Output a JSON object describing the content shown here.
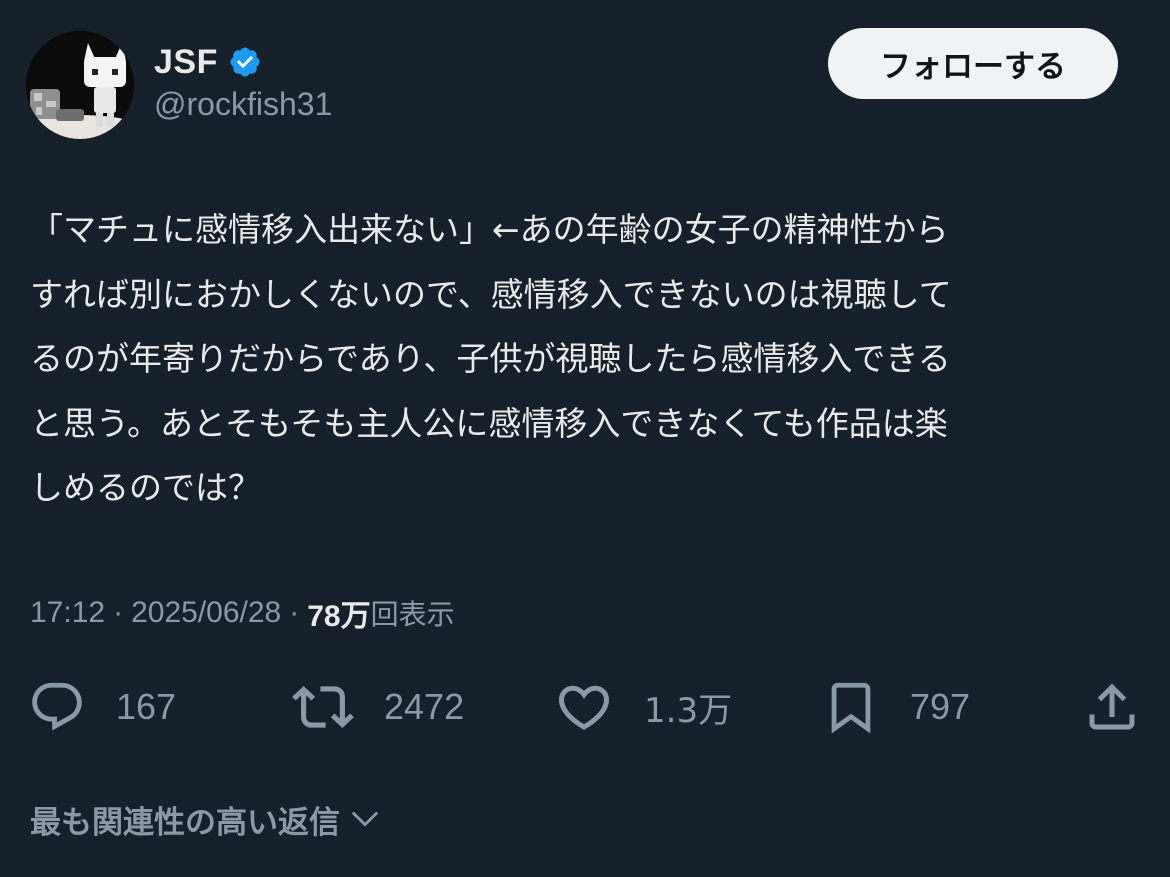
{
  "author": {
    "display_name": "JSF",
    "handle": "@rockfish31",
    "verified": true
  },
  "follow_label": "フォローする",
  "tweet": {
    "lines": [
      "「マチュに感情移入出来ない」←あの年齢の女子の精神性から",
      "すれば別におかしくないので、感情移入できないのは視聴して",
      "るのが年寄りだからであり、子供が視聴したら感情移入できる",
      "と思う。あとそもそも主人公に感情移入できなくても作品は楽",
      "しめるのでは？"
    ]
  },
  "meta": {
    "time": "17:12",
    "date": "2025/06/28",
    "separator": "·",
    "views_count": "78万",
    "views_label": "回表示"
  },
  "actions": {
    "reply": {
      "icon": "reply-icon",
      "count": "167"
    },
    "retweet": {
      "icon": "retweet-icon",
      "count": "2472"
    },
    "like": {
      "icon": "heart-icon",
      "count": "1.3万"
    },
    "bookmark": {
      "icon": "bookmark-icon",
      "count": "797"
    },
    "share": {
      "icon": "share-icon"
    }
  },
  "replies_sort_label": "最も関連性の高い返信",
  "colors": {
    "background": "#15202b",
    "text_primary": "#e7e9ea",
    "text_secondary": "#8b98a5",
    "verified": "#1d9bf0",
    "follow_button_bg": "#eff3f4"
  }
}
